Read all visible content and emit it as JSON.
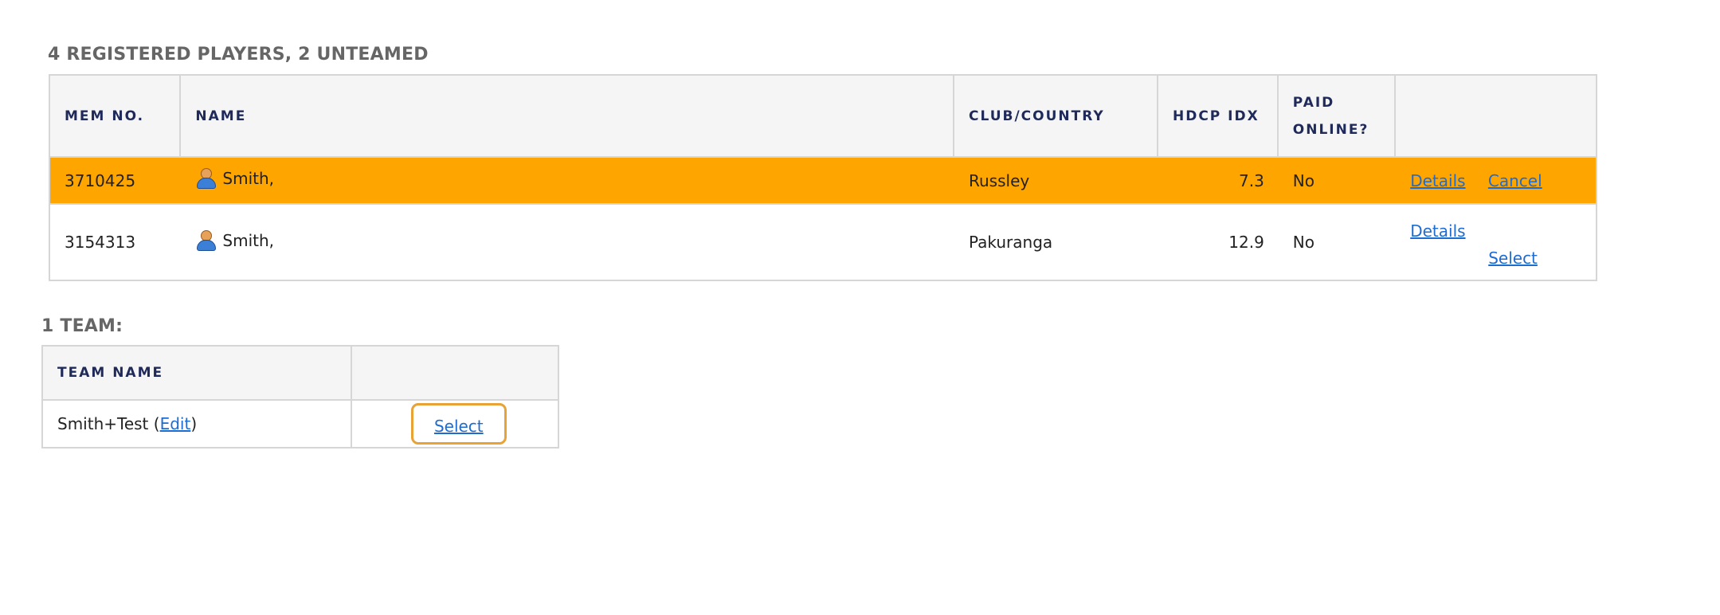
{
  "players_section": {
    "heading": "4 REGISTERED PLAYERS, 2 UNTEAMED",
    "columns": {
      "mem_no": "MEM NO.",
      "name": "NAME",
      "club_country": "CLUB/COUNTRY",
      "hdcp_idx": "HDCP IDX",
      "paid_online_line1": "PAID",
      "paid_online_line2": "ONLINE?"
    },
    "rows": [
      {
        "mem_no": "3710425",
        "name": "Smith,",
        "club": "Russley",
        "hdcp": "7.3",
        "paid": "No",
        "details_label": "Details",
        "cancel_label": "Cancel",
        "highlighted": true
      },
      {
        "mem_no": "3154313",
        "name": "Smith,",
        "club": "Pakuranga",
        "hdcp": "12.9",
        "paid": "No",
        "details_label": "Details",
        "select_label": "Select",
        "highlighted": false
      }
    ],
    "icon": "user-icon",
    "highlight_color": "#ffa500"
  },
  "teams_section": {
    "heading": "1 TEAM:",
    "columns": {
      "team_name": "TEAM NAME"
    },
    "rows": [
      {
        "team_name": "Smith+Test",
        "open_paren": "(",
        "edit_label": "Edit",
        "close_paren": ")",
        "select_label": "Select"
      }
    ],
    "focus_color": "#e8a235"
  },
  "colors": {
    "link": "#1f6cd1",
    "header_text": "#1f2a5a",
    "section_heading": "#666666",
    "header_bg": "#f5f5f5",
    "border": "#d6d6d6"
  }
}
